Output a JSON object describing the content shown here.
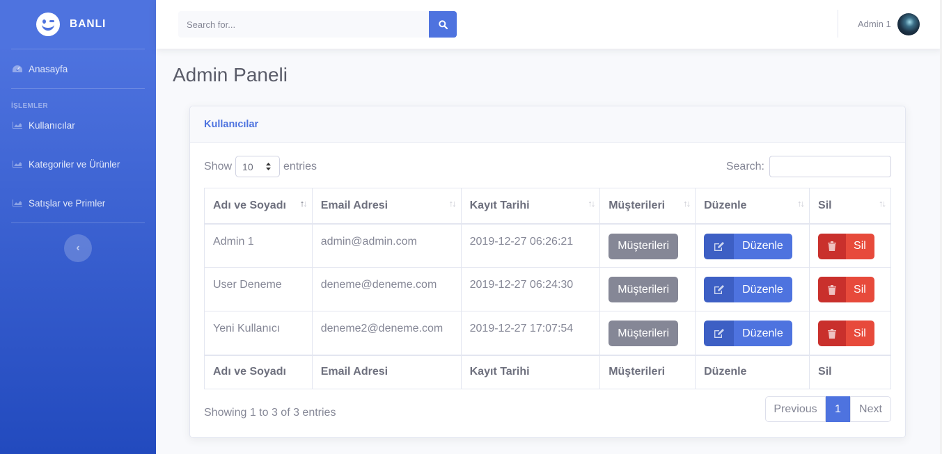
{
  "sidebar": {
    "brand": "BANLI",
    "home": "Anasayfa",
    "heading": "İŞLEMLER",
    "items": [
      {
        "label": "Kullanıcılar",
        "icon": "chart-area-icon"
      },
      {
        "label": "Kategoriler ve Ürünler",
        "icon": "chart-area-icon"
      },
      {
        "label": "Satışlar ve Primler",
        "icon": "chart-area-icon"
      }
    ],
    "toggle": "‹"
  },
  "topbar": {
    "search_placeholder": "Search for...",
    "user_name": "Admin 1"
  },
  "page": {
    "title": "Admin Paneli"
  },
  "card": {
    "title": "Kullanıcılar",
    "show_label": "Show",
    "length_value": "10",
    "entries_label": "entries",
    "search_label": "Search:",
    "columns": [
      "Adı ve Soyadı",
      "Email Adresi",
      "Kayıt Tarihi",
      "Müşterileri",
      "Düzenle",
      "Sil"
    ],
    "rows": [
      {
        "name": "Admin 1",
        "email": "admin@admin.com",
        "date": "2019-12-27 06:26:21"
      },
      {
        "name": "User Deneme",
        "email": "deneme@deneme.com",
        "date": "2019-12-27 06:24:30"
      },
      {
        "name": "Yeni Kullanıcı",
        "email": "deneme2@deneme.com",
        "date": "2019-12-27 17:07:54"
      }
    ],
    "btn_customers": "Müşterileri",
    "btn_edit": "Düzenle",
    "btn_delete": "Sil",
    "info": "Showing 1 to 3 of 3 entries",
    "pagination": {
      "prev": "Previous",
      "current": "1",
      "next": "Next"
    }
  },
  "colors": {
    "primary": "#4e73df",
    "danger": "#e74a3b",
    "secondary": "#858796"
  }
}
